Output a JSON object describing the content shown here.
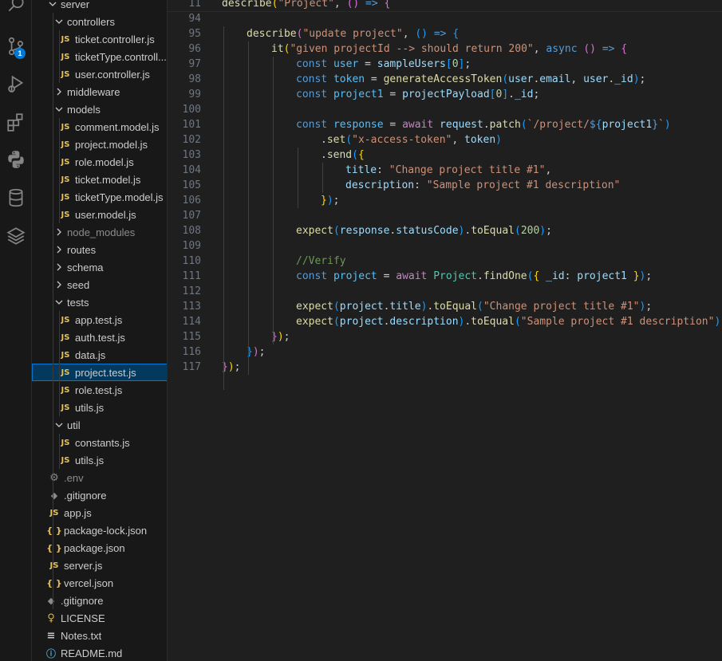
{
  "activity_bar": {
    "icons": [
      {
        "name": "search-icon"
      },
      {
        "name": "source-control-icon",
        "badge": "1"
      },
      {
        "name": "run-debug-icon"
      },
      {
        "name": "extensions-icon"
      },
      {
        "name": "python-icon"
      },
      {
        "name": "database-icon"
      },
      {
        "name": "layers-icon"
      }
    ],
    "accent_color": "#0078d4"
  },
  "explorer": {
    "items": [
      {
        "label": "server",
        "type": "folder",
        "open": true,
        "depth": 0
      },
      {
        "label": "controllers",
        "type": "folder",
        "open": true,
        "depth": 1
      },
      {
        "label": "ticket.controller.js",
        "type": "js",
        "depth": 2
      },
      {
        "label": "ticketType.controll...",
        "type": "js",
        "depth": 2
      },
      {
        "label": "user.controller.js",
        "type": "js",
        "depth": 2
      },
      {
        "label": "middleware",
        "type": "folder",
        "open": false,
        "depth": 1
      },
      {
        "label": "models",
        "type": "folder",
        "open": true,
        "depth": 1
      },
      {
        "label": "comment.model.js",
        "type": "js",
        "depth": 2
      },
      {
        "label": "project.model.js",
        "type": "js",
        "depth": 2
      },
      {
        "label": "role.model.js",
        "type": "js",
        "depth": 2
      },
      {
        "label": "ticket.model.js",
        "type": "js",
        "depth": 2
      },
      {
        "label": "ticketType.model.js",
        "type": "js",
        "depth": 2
      },
      {
        "label": "user.model.js",
        "type": "js",
        "depth": 2
      },
      {
        "label": "node_modules",
        "type": "folder",
        "open": false,
        "depth": 1,
        "dim": true
      },
      {
        "label": "routes",
        "type": "folder",
        "open": false,
        "depth": 1
      },
      {
        "label": "schema",
        "type": "folder",
        "open": false,
        "depth": 1
      },
      {
        "label": "seed",
        "type": "folder",
        "open": false,
        "depth": 1
      },
      {
        "label": "tests",
        "type": "folder",
        "open": true,
        "depth": 1
      },
      {
        "label": "app.test.js",
        "type": "js",
        "depth": 2
      },
      {
        "label": "auth.test.js",
        "type": "js",
        "depth": 2
      },
      {
        "label": "data.js",
        "type": "js",
        "depth": 2
      },
      {
        "label": "project.test.js",
        "type": "js",
        "depth": 2,
        "selected": true
      },
      {
        "label": "role.test.js",
        "type": "js",
        "depth": 2
      },
      {
        "label": "utils.js",
        "type": "js",
        "depth": 2
      },
      {
        "label": "util",
        "type": "folder",
        "open": true,
        "depth": 1
      },
      {
        "label": "constants.js",
        "type": "js",
        "depth": 2
      },
      {
        "label": "utils.js",
        "type": "js",
        "depth": 2
      },
      {
        "label": ".env",
        "type": "env",
        "depth": 1,
        "dim": true
      },
      {
        "label": ".gitignore",
        "type": "git",
        "depth": 1
      },
      {
        "label": "app.js",
        "type": "js",
        "depth": 1
      },
      {
        "label": "package-lock.json",
        "type": "json",
        "depth": 1
      },
      {
        "label": "package.json",
        "type": "json",
        "depth": 1
      },
      {
        "label": "server.js",
        "type": "js",
        "depth": 1
      },
      {
        "label": "vercel.json",
        "type": "json",
        "depth": 1
      },
      {
        "label": ".gitignore",
        "type": "git",
        "depth": 0
      },
      {
        "label": "LICENSE",
        "type": "lic",
        "depth": 0
      },
      {
        "label": "Notes.txt",
        "type": "txt",
        "depth": 0
      },
      {
        "label": "README.md",
        "type": "md",
        "depth": 0
      }
    ]
  },
  "editor": {
    "lines": [
      {
        "num": "11",
        "indent": 0,
        "tokens": [
          [
            "fn",
            "describe"
          ],
          [
            "p1",
            "("
          ],
          [
            "str",
            "\"Project\""
          ],
          [
            "pl",
            ", "
          ],
          [
            "p2",
            "()"
          ],
          [
            "pl",
            " "
          ],
          [
            "kw",
            "=>"
          ],
          [
            "pl",
            " "
          ],
          [
            "p2",
            "{"
          ]
        ]
      },
      {
        "num": "94",
        "indent": 0,
        "tokens": []
      },
      {
        "num": "95",
        "indent": 1,
        "tokens": [
          [
            "fn",
            "describe"
          ],
          [
            "p2",
            "("
          ],
          [
            "str",
            "\"update project\""
          ],
          [
            "pl",
            ", "
          ],
          [
            "p3",
            "()"
          ],
          [
            "pl",
            " "
          ],
          [
            "kw",
            "=>"
          ],
          [
            "pl",
            " "
          ],
          [
            "p3",
            "{"
          ]
        ]
      },
      {
        "num": "96",
        "indent": 2,
        "tokens": [
          [
            "fn",
            "it"
          ],
          [
            "p1",
            "("
          ],
          [
            "str",
            "\"given projectId --> should return 200\""
          ],
          [
            "pl",
            ", "
          ],
          [
            "kw",
            "async"
          ],
          [
            "pl",
            " "
          ],
          [
            "p2",
            "()"
          ],
          [
            "pl",
            " "
          ],
          [
            "kw",
            "=>"
          ],
          [
            "pl",
            " "
          ],
          [
            "p2",
            "{"
          ]
        ]
      },
      {
        "num": "97",
        "indent": 3,
        "tokens": [
          [
            "kw",
            "const"
          ],
          [
            "pl",
            " "
          ],
          [
            "cst",
            "user"
          ],
          [
            "pl",
            " = "
          ],
          [
            "var",
            "sampleUsers"
          ],
          [
            "p3",
            "["
          ],
          [
            "num",
            "0"
          ],
          [
            "p3",
            "]"
          ],
          [
            "pl",
            ";"
          ]
        ]
      },
      {
        "num": "98",
        "indent": 3,
        "tokens": [
          [
            "kw",
            "const"
          ],
          [
            "pl",
            " "
          ],
          [
            "cst",
            "token"
          ],
          [
            "pl",
            " = "
          ],
          [
            "fn",
            "generateAccessToken"
          ],
          [
            "p3",
            "("
          ],
          [
            "var",
            "user"
          ],
          [
            "pl",
            "."
          ],
          [
            "var",
            "email"
          ],
          [
            "pl",
            ", "
          ],
          [
            "var",
            "user"
          ],
          [
            "pl",
            "."
          ],
          [
            "var",
            "_id"
          ],
          [
            "p3",
            ")"
          ],
          [
            "pl",
            ";"
          ]
        ]
      },
      {
        "num": "99",
        "indent": 3,
        "tokens": [
          [
            "kw",
            "const"
          ],
          [
            "pl",
            " "
          ],
          [
            "cst",
            "project1"
          ],
          [
            "pl",
            " = "
          ],
          [
            "var",
            "projectPayload"
          ],
          [
            "p3",
            "["
          ],
          [
            "num",
            "0"
          ],
          [
            "p3",
            "]"
          ],
          [
            "pl",
            "."
          ],
          [
            "var",
            "_id"
          ],
          [
            "pl",
            ";"
          ]
        ]
      },
      {
        "num": "100",
        "indent": 3,
        "tokens": []
      },
      {
        "num": "101",
        "indent": 3,
        "tokens": [
          [
            "kw",
            "const"
          ],
          [
            "pl",
            " "
          ],
          [
            "cst",
            "response"
          ],
          [
            "pl",
            " = "
          ],
          [
            "ctl",
            "await"
          ],
          [
            "pl",
            " "
          ],
          [
            "var",
            "request"
          ],
          [
            "pl",
            "."
          ],
          [
            "fn",
            "patch"
          ],
          [
            "p3",
            "("
          ],
          [
            "str",
            "`/project/"
          ],
          [
            "kw",
            "${"
          ],
          [
            "var",
            "project1"
          ],
          [
            "kw",
            "}"
          ],
          [
            "str",
            "`"
          ],
          [
            "p3",
            ")"
          ]
        ]
      },
      {
        "num": "102",
        "indent": 4,
        "tokens": [
          [
            "pl",
            "."
          ],
          [
            "fn",
            "set"
          ],
          [
            "p3",
            "("
          ],
          [
            "str",
            "\"x-access-token\""
          ],
          [
            "pl",
            ", "
          ],
          [
            "var",
            "token"
          ],
          [
            "p3",
            ")"
          ]
        ]
      },
      {
        "num": "103",
        "indent": 4,
        "tokens": [
          [
            "pl",
            "."
          ],
          [
            "fn",
            "send"
          ],
          [
            "p3",
            "("
          ],
          [
            "p1",
            "{"
          ]
        ]
      },
      {
        "num": "104",
        "indent": 5,
        "tokens": [
          [
            "var",
            "title"
          ],
          [
            "pl",
            ": "
          ],
          [
            "str",
            "\"Change project title #1\""
          ],
          [
            "pl",
            ","
          ]
        ]
      },
      {
        "num": "105",
        "indent": 5,
        "tokens": [
          [
            "var",
            "description"
          ],
          [
            "pl",
            ": "
          ],
          [
            "str",
            "\"Sample project #1 description\""
          ]
        ]
      },
      {
        "num": "106",
        "indent": 4,
        "tokens": [
          [
            "p1",
            "}"
          ],
          [
            "p3",
            ")"
          ],
          [
            "pl",
            ";"
          ]
        ]
      },
      {
        "num": "107",
        "indent": 3,
        "tokens": []
      },
      {
        "num": "108",
        "indent": 3,
        "tokens": [
          [
            "fn",
            "expect"
          ],
          [
            "p3",
            "("
          ],
          [
            "var",
            "response"
          ],
          [
            "pl",
            "."
          ],
          [
            "var",
            "statusCode"
          ],
          [
            "p3",
            ")"
          ],
          [
            "pl",
            "."
          ],
          [
            "fn",
            "toEqual"
          ],
          [
            "p3",
            "("
          ],
          [
            "num",
            "200"
          ],
          [
            "p3",
            ")"
          ],
          [
            "pl",
            ";"
          ]
        ]
      },
      {
        "num": "109",
        "indent": 3,
        "tokens": []
      },
      {
        "num": "110",
        "indent": 3,
        "tokens": [
          [
            "cm",
            "//Verify"
          ]
        ]
      },
      {
        "num": "111",
        "indent": 3,
        "tokens": [
          [
            "kw",
            "const"
          ],
          [
            "pl",
            " "
          ],
          [
            "cst",
            "project"
          ],
          [
            "pl",
            " = "
          ],
          [
            "ctl",
            "await"
          ],
          [
            "pl",
            " "
          ],
          [
            "cls",
            "Project"
          ],
          [
            "pl",
            "."
          ],
          [
            "fn",
            "findOne"
          ],
          [
            "p3",
            "("
          ],
          [
            "p1",
            "{"
          ],
          [
            "pl",
            " "
          ],
          [
            "var",
            "_id"
          ],
          [
            "pl",
            ": "
          ],
          [
            "var",
            "project1"
          ],
          [
            "pl",
            " "
          ],
          [
            "p1",
            "}"
          ],
          [
            "p3",
            ")"
          ],
          [
            "pl",
            ";"
          ]
        ]
      },
      {
        "num": "112",
        "indent": 3,
        "tokens": []
      },
      {
        "num": "113",
        "indent": 3,
        "tokens": [
          [
            "fn",
            "expect"
          ],
          [
            "p3",
            "("
          ],
          [
            "var",
            "project"
          ],
          [
            "pl",
            "."
          ],
          [
            "var",
            "title"
          ],
          [
            "p3",
            ")"
          ],
          [
            "pl",
            "."
          ],
          [
            "fn",
            "toEqual"
          ],
          [
            "p3",
            "("
          ],
          [
            "str",
            "\"Change project title #1\""
          ],
          [
            "p3",
            ")"
          ],
          [
            "pl",
            ";"
          ]
        ]
      },
      {
        "num": "114",
        "indent": 3,
        "tokens": [
          [
            "fn",
            "expect"
          ],
          [
            "p3",
            "("
          ],
          [
            "var",
            "project"
          ],
          [
            "pl",
            "."
          ],
          [
            "var",
            "description"
          ],
          [
            "p3",
            ")"
          ],
          [
            "pl",
            "."
          ],
          [
            "fn",
            "toEqual"
          ],
          [
            "p3",
            "("
          ],
          [
            "str",
            "\"Sample project #1 description\""
          ],
          [
            "p3",
            ")"
          ],
          [
            "pl",
            ";"
          ]
        ]
      },
      {
        "num": "115",
        "indent": 2,
        "tokens": [
          [
            "p2",
            "}"
          ],
          [
            "p1",
            ")"
          ],
          [
            "pl",
            ";"
          ]
        ]
      },
      {
        "num": "116",
        "indent": 1,
        "tokens": [
          [
            "p3",
            "}"
          ],
          [
            "p2",
            ")"
          ],
          [
            "pl",
            ";"
          ]
        ]
      },
      {
        "num": "117",
        "indent": 0,
        "tokens": [
          [
            "p2",
            "}"
          ],
          [
            "p1",
            ")"
          ],
          [
            "pl",
            ";"
          ]
        ]
      }
    ]
  }
}
